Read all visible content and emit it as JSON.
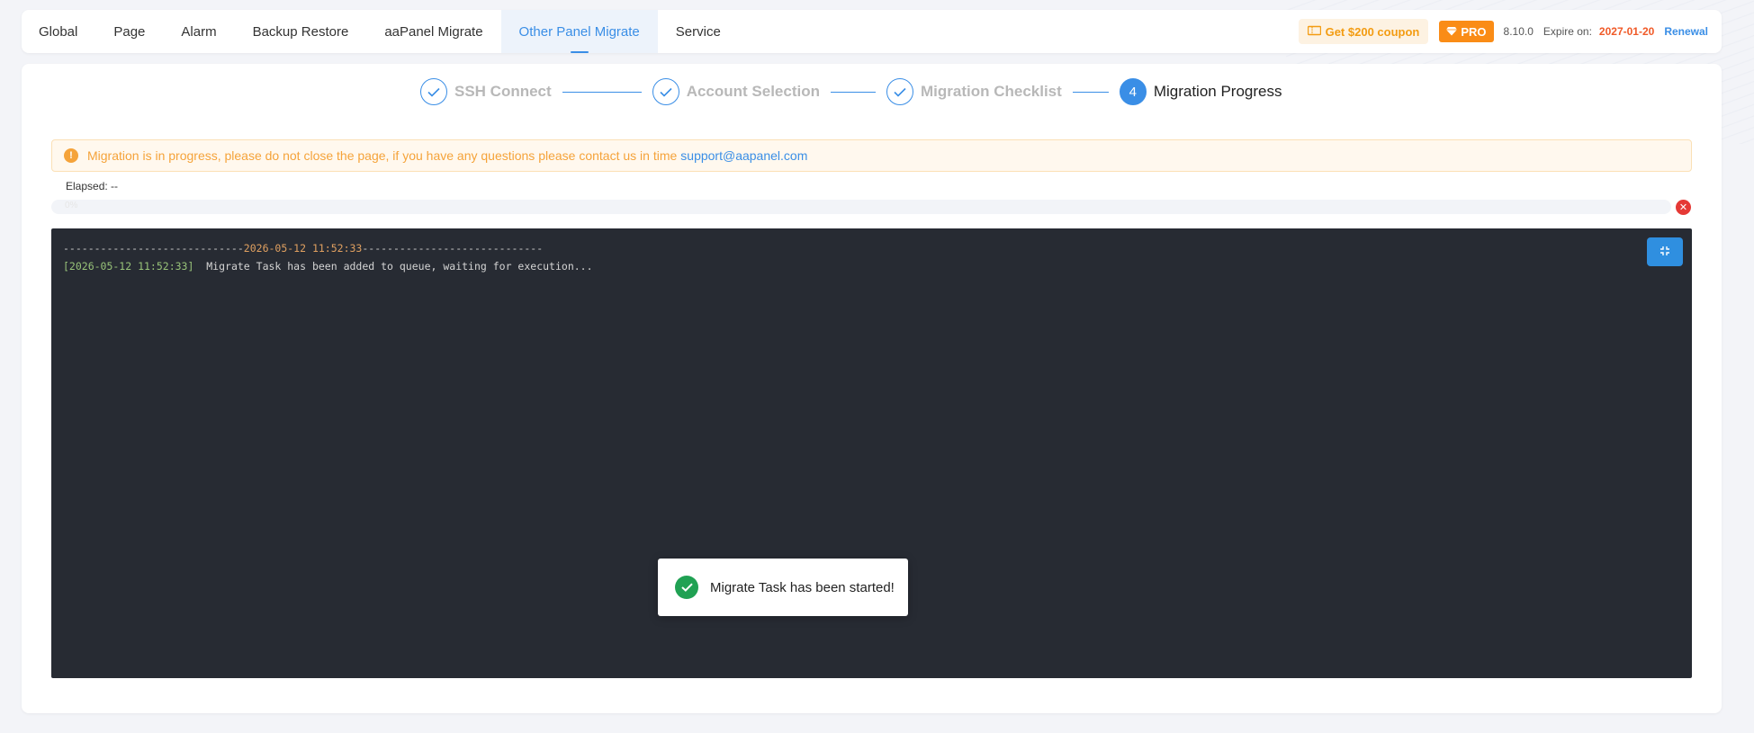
{
  "nav": {
    "tabs": [
      {
        "label": "Global"
      },
      {
        "label": "Page"
      },
      {
        "label": "Alarm"
      },
      {
        "label": "Backup Restore"
      },
      {
        "label": "aaPanel Migrate"
      },
      {
        "label": "Other Panel Migrate",
        "active": true
      },
      {
        "label": "Service"
      }
    ],
    "coupon_label": "Get $200 coupon",
    "pro_label": "PRO",
    "version": "8.10.0",
    "expire_label": "Expire on:",
    "expire_date": "2027-01-20",
    "renewal_label": "Renewal"
  },
  "steps": [
    {
      "number": "1",
      "label": "SSH Connect",
      "status": "done"
    },
    {
      "number": "2",
      "label": "Account Selection",
      "status": "done"
    },
    {
      "number": "3",
      "label": "Migration Checklist",
      "status": "done"
    },
    {
      "number": "4",
      "label": "Migration Progress",
      "status": "current"
    }
  ],
  "alert": {
    "text": "Migration is in progress, please do not close the page, if you have any questions please contact us in time",
    "email": "support@aapanel.com"
  },
  "elapsed": "Elapsed: --",
  "progress": {
    "percent": 0,
    "label": "0%"
  },
  "terminal": {
    "dashes_left": "-----------------------------",
    "header_timestamp": "2026-05-12 11:52:33",
    "dashes_right": "-----------------------------",
    "log_timestamp": "[2026-05-12 11:52:33]",
    "log_message": "  Migrate Task has been added to queue, waiting for execution..."
  },
  "toast": {
    "message": "Migrate Task has been started!"
  },
  "colors": {
    "accent": "#3a8ee6",
    "warning": "#f5a33a",
    "danger": "#e53935",
    "success": "#20a153",
    "terminal_bg": "#272b33"
  }
}
